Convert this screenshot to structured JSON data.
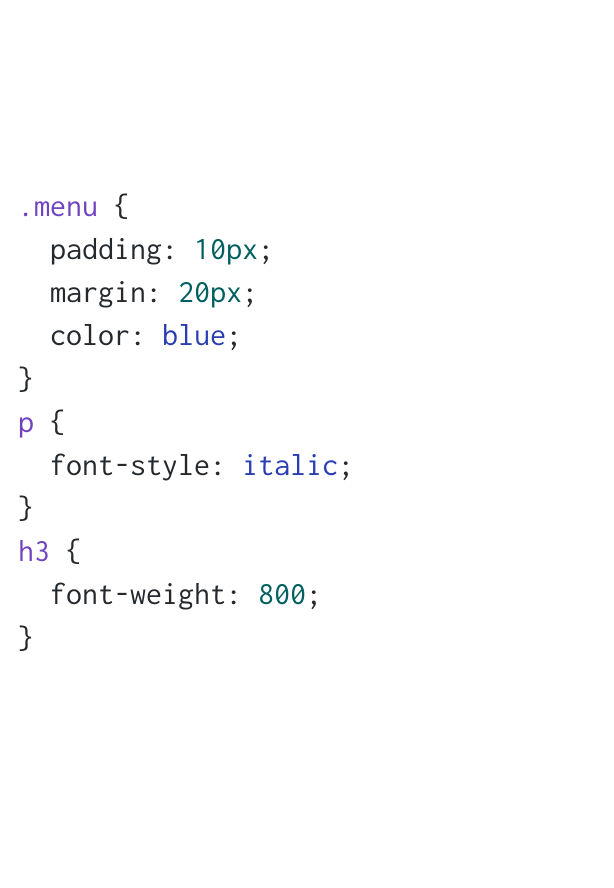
{
  "code": {
    "rules": [
      {
        "selector": ".menu",
        "selector_kind": "class",
        "declarations": [
          {
            "property": "padding",
            "value": "10px",
            "value_kind": "number"
          },
          {
            "property": "margin",
            "value": "20px",
            "value_kind": "number"
          },
          {
            "property": "color",
            "value": "blue",
            "value_kind": "ident"
          }
        ]
      },
      {
        "selector": "p",
        "selector_kind": "tag",
        "declarations": [
          {
            "property": "font-style",
            "value": "italic",
            "value_kind": "ident"
          }
        ]
      },
      {
        "selector": "h3",
        "selector_kind": "tag",
        "declarations": [
          {
            "property": "font-weight",
            "value": "800",
            "value_kind": "number"
          }
        ]
      }
    ]
  }
}
